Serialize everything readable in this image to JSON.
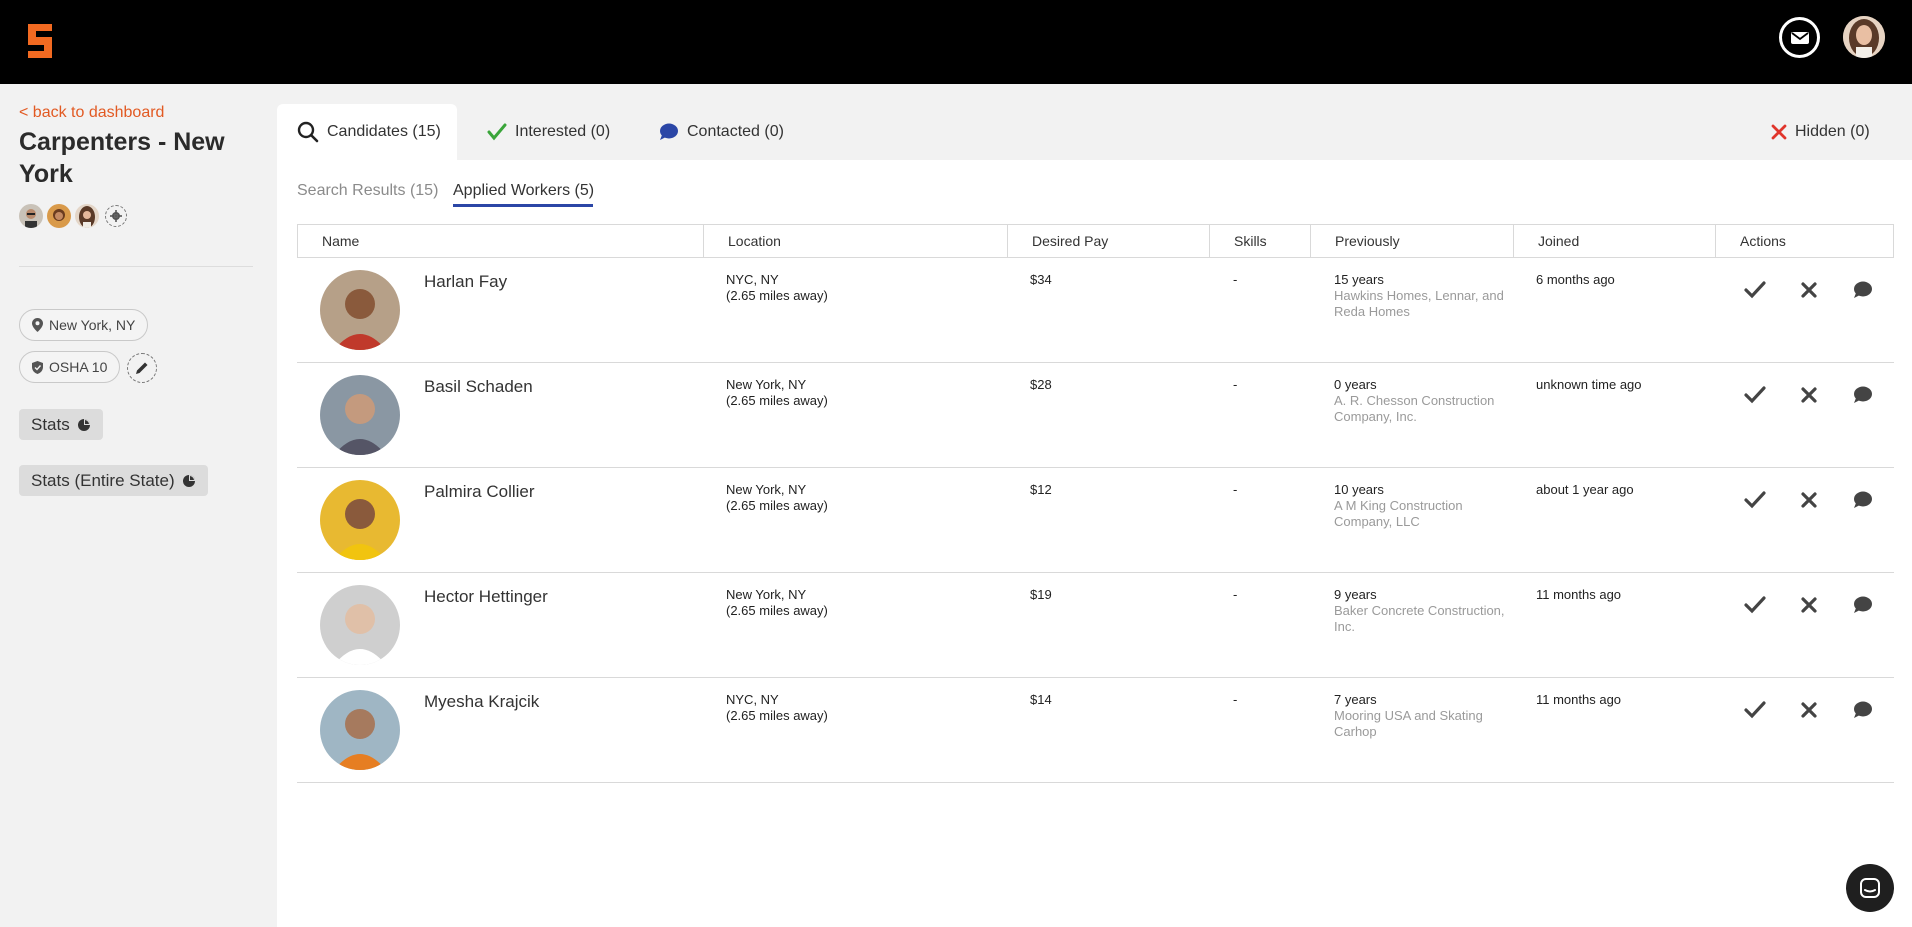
{
  "header": {
    "logo_icon": "s-logo-icon",
    "mail_icon": "envelope-icon",
    "brand_color": "#f26a21"
  },
  "sidebar": {
    "back_label": "< back to dashboard",
    "title": "Carpenters - New York",
    "location_chip": "New York, NY",
    "cert_chip": "OSHA 10",
    "stats_label": "Stats",
    "stats_state_label": "Stats (Entire State)"
  },
  "tabs": [
    {
      "label": "Candidates (15)",
      "icon": "search-icon"
    },
    {
      "label": "Interested (0)",
      "icon": "check-icon",
      "color": "#3aa53a"
    },
    {
      "label": "Contacted (0)",
      "icon": "speech-bubble-icon",
      "color": "#2b46a6"
    },
    {
      "label": "Hidden (0)",
      "icon": "close-icon",
      "color": "#e0352b"
    }
  ],
  "subtabs": [
    {
      "label": "Search Results (15)"
    },
    {
      "label": "Applied Workers (5)"
    }
  ],
  "table": {
    "columns": [
      "Name",
      "Location",
      "Desired Pay",
      "Skills",
      "Previously",
      "Joined",
      "Actions"
    ],
    "rows": [
      {
        "name": "Harlan Fay",
        "location": "NYC, NY",
        "distance": "(2.65 miles away)",
        "pay": "$34",
        "skills": "-",
        "years": "15 years",
        "companies": "Hawkins Homes, Lennar, and Reda Homes",
        "joined": "6 months ago"
      },
      {
        "name": "Basil Schaden",
        "location": "New York, NY",
        "distance": "(2.65 miles away)",
        "pay": "$28",
        "skills": "-",
        "years": "0 years",
        "companies": "A. R. Chesson Construction Company, Inc.",
        "joined": "unknown time ago"
      },
      {
        "name": "Palmira Collier",
        "location": "New York, NY",
        "distance": "(2.65 miles away)",
        "pay": "$12",
        "skills": "-",
        "years": "10 years",
        "companies": "A M King Construction Company, LLC",
        "joined": "about 1 year ago"
      },
      {
        "name": "Hector Hettinger",
        "location": "New York, NY",
        "distance": "(2.65 miles away)",
        "pay": "$19",
        "skills": "-",
        "years": "9 years",
        "companies": "Baker Concrete Construction, Inc.",
        "joined": "11 months ago"
      },
      {
        "name": "Myesha Krajcik",
        "location": "NYC, NY",
        "distance": "(2.65 miles away)",
        "pay": "$14",
        "skills": "-",
        "years": "7 years",
        "companies": "Mooring USA and Skating Carhop",
        "joined": "11 months ago"
      }
    ]
  }
}
